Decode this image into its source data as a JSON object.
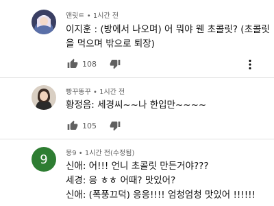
{
  "comments": [
    {
      "author": "앤릿ㅌ",
      "time": "1시간 전",
      "separator": "•",
      "lines": [
        "이지훈 : (방에서 나오며) 어 뭐야 웬 초콜릿? (초콜릿",
        "을 먹으며 밖으로 퇴장)"
      ],
      "likes": "108"
    },
    {
      "author": "빵꾸똥꾸",
      "time": "1시간 전",
      "separator": "•",
      "lines": [
        "황정음: 세경씨~~나 한입만~~~~"
      ],
      "likes": "105"
    },
    {
      "author": "몽9",
      "time": "1시간 전(수정됨)",
      "separator": "•",
      "avatar_letter": "9",
      "lines": [
        "신애: 어!!! 언니 초콜릿 만든거야???",
        "세경: 응 ㅎㅎ 어때? 맛있어?",
        "신애: (폭풍끄덕) 응응!!!! 엄청엄청 맛있어 !!!!!!"
      ]
    }
  ],
  "colors": {
    "letter_avatar_bg": "#2e7d32",
    "meta_text": "#606060",
    "body_text": "#0f0f0f"
  }
}
